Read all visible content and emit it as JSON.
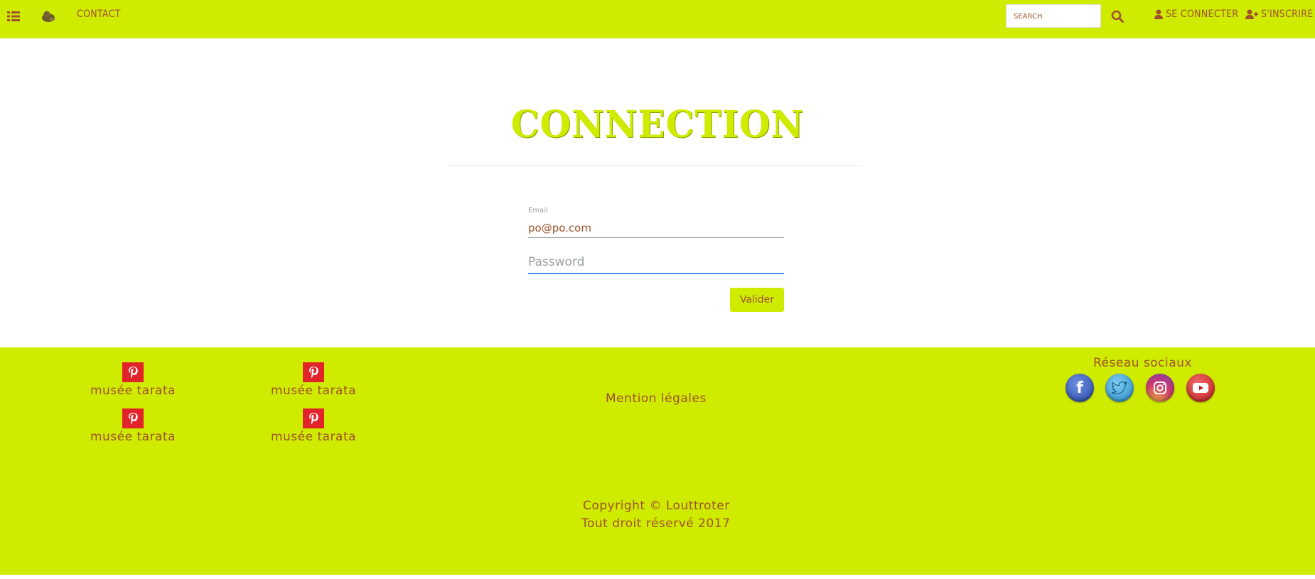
{
  "navbar": {
    "menu_icon": "list-icon",
    "brand_icon": "otter-icon",
    "contact_label": "Contact",
    "search_placeholder": "Search",
    "search_icon": "search-icon",
    "login_label": "Se connecter",
    "signup_label": "S'inscrire"
  },
  "main": {
    "title": "Connection",
    "email_label": "Email",
    "email_value": "po@po.com",
    "password_placeholder": "Password",
    "submit_label": "Valider"
  },
  "footer": {
    "pin_items": [
      {
        "label": "musée tarata"
      },
      {
        "label": "musée tarata"
      },
      {
        "label": "musée tarata"
      },
      {
        "label": "musée tarata"
      }
    ],
    "legal_label": "Mention légales",
    "social_title": "Réseau sociaux",
    "social_icons": [
      "facebook-icon",
      "twitter-icon",
      "instagram-icon",
      "youtube-icon"
    ],
    "copyright_line1": "Copyright © Louttroter",
    "copyright_line2": "Tout droit réservé 2017"
  },
  "colors": {
    "accent": "#cfeb00",
    "text": "#a0522d",
    "pinterest": "#e3232a",
    "focus": "#4a90e2"
  }
}
